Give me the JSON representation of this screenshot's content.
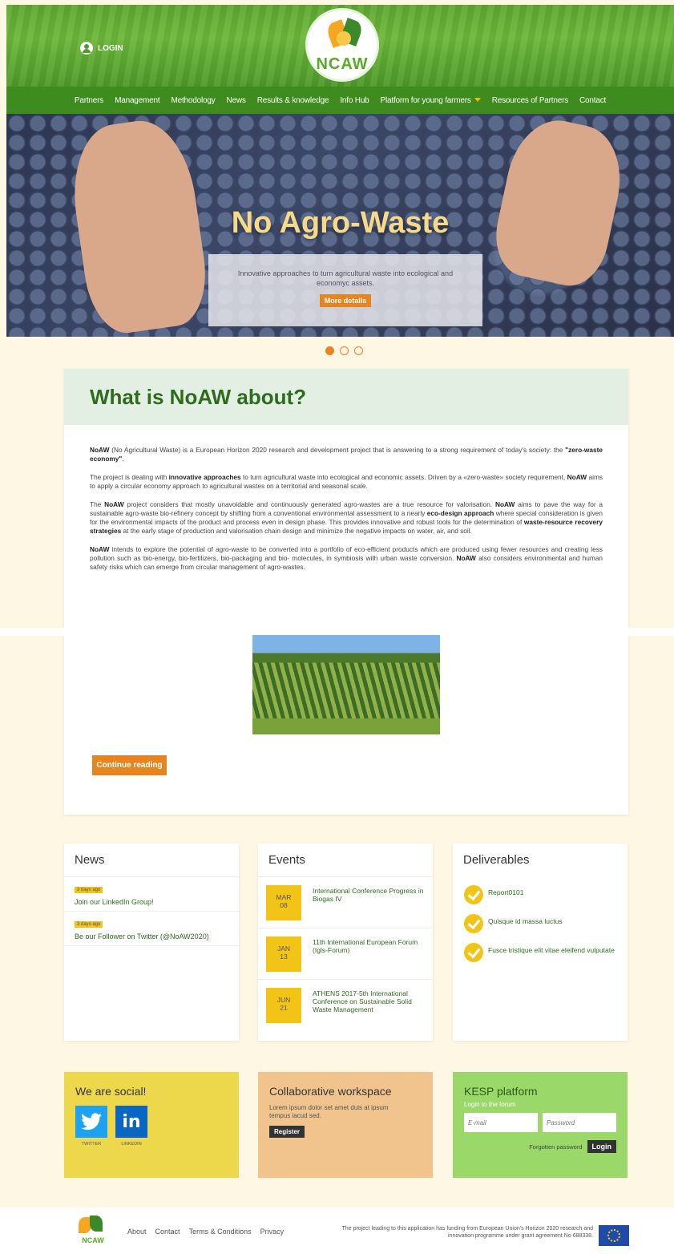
{
  "header": {
    "login_label": "LOGIN",
    "logo_text": "NCAW"
  },
  "nav": {
    "items": [
      "Partners",
      "Management",
      "Methodology",
      "News",
      "Results & knowledge",
      "Info Hub",
      "Platform for young farmers",
      "Resources of Partners",
      "Contact"
    ]
  },
  "hero": {
    "title": "No Agro-Waste",
    "text": "Innovative approaches to turn agricultural waste into ecological and economyc assets.",
    "button": "More details"
  },
  "about": {
    "title": "What is NoAW about?",
    "p1_b1": "NoAW",
    "p1_t1": " (No Agricultural Waste) is a European Horizon 2020 research and development project that is answering to a strong requirement of today's society: the ",
    "p1_b2": "\"zero-waste economy\"",
    "p1_t2": ".",
    "p2_t1": "The project is dealing with ",
    "p2_b1": "innovative approaches",
    "p2_t2": " to turn agricultural waste into ecological and economic assets. Driven by a «zero-waste» society requirement, ",
    "p2_b2": "NoAW",
    "p2_t3": " aims to apply a circular economy approach to agricultural wastes on a territorial and seasonal scale.",
    "p3_t1": "The ",
    "p3_b1": "NoAW",
    "p3_t2": " project considers that mostly unavoidable and continuously generated agro-wastes are a true resource for valorisation.  ",
    "p3_b2": "NoAW",
    "p3_t3": " aims to pave the way for a sustainable agro-waste bio-refinery concept by shifting from a conventional environmental assessment to a nearly ",
    "p3_b3": "eco-design approach",
    "p3_t4": " where special consideration is given for the environmental impacts of the product and process even in design phase. This provides innovative and robust tools for the determination of ",
    "p3_b4": "waste-resource recovery strategies",
    "p3_t5": " at the early stage of production and valorisation chain design and minimize the negative impacts on water, air, and soil.",
    "p4_b1": "NoAW",
    "p4_t1": " intends to explore the potential of agro-waste to be converted into a portfolio of eco-efficient products which are produced using fewer resources and creating less pollution such as bio-energy, bio-fertilizers, bio-packaging and bio- molecules, in symbiosis with urban waste conversion. ",
    "p4_b2": "NoAW",
    "p4_t2": " also considers environmental and human safety risks which can emerge from circular management of agro-wastes.",
    "continue_button": "Continue reading"
  },
  "news": {
    "title": "News",
    "items": [
      {
        "badge": "3 days ago",
        "title": "Join our LinkedIn Group!"
      },
      {
        "badge": "3 days ago",
        "title": "Be our Follower on Twitter (@NoAW2020)"
      }
    ]
  },
  "events": {
    "title": "Events",
    "items": [
      {
        "month": "MAR",
        "day": "08",
        "title": "International Conference Progress in Biogas IV"
      },
      {
        "month": "JAN",
        "day": "13",
        "title": "11th International European Forum (Igls-Forum)"
      },
      {
        "month": "JUN",
        "day": "21",
        "title": "ATHENS 2017-5th International Conference on Sustainable Solid Waste Management"
      }
    ]
  },
  "deliverables": {
    "title": "Deliverables",
    "items": [
      "Report0101",
      "Quisque id massa luctus",
      "Fusce tristique elit vitae eleifend vulputate"
    ]
  },
  "social": {
    "title": "We are social!",
    "twitter_label": "TWITTER",
    "linkedin_label": "LINKEDIN",
    "linkedin_glyph": "in"
  },
  "collab": {
    "title": "Collaborative workspace",
    "text": "Lorem ipsum dolor set amet duis at ipsum tempus iacud sed.",
    "button": "Register"
  },
  "kesp": {
    "title": "KESP platform",
    "label": "Login to the forum",
    "email_placeholder": "E-mail",
    "password_placeholder": "Password",
    "forgot": "Forgotten password",
    "button": "Login"
  },
  "footer": {
    "logo_text": "NCAW",
    "links": [
      "About",
      "Contact",
      "Terms & Conditions",
      "Privacy"
    ],
    "note": "The project leading to this application has funding from European Union's Horizon 2020 research and innovation programme under grant agreement No 688338."
  }
}
